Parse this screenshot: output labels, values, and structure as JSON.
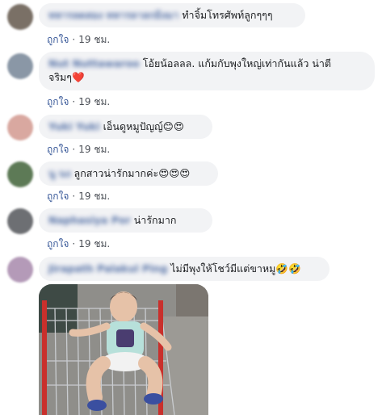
{
  "comments": [
    {
      "author": "ทหารลดสอง ทหารลาลกมิงมา",
      "text": "ทำจิ้มโทรศัพท์ลูกๆๆๆ",
      "like_label": "ถูกใจ",
      "time": "19 ชม.",
      "avatar_color": "#7a7066"
    },
    {
      "author": "Nut Nuttawaroo",
      "text_line1": "โอ้ยน้อลลล. แก้มกับพุงใหญ่เท่ากันแล้ว น่าตี",
      "text_line2": "จริมๆ❤️",
      "like_label": "ถูกใจ",
      "time": "19 ชม.",
      "avatar_color": "#8a97a6"
    },
    {
      "author": "Yuki Yuki",
      "text": "เอ็นดูหมูปัญญ์😊😍",
      "like_label": "ถูกใจ",
      "time": "19 ชม.",
      "avatar_color": "#d9a8a0"
    },
    {
      "author": "นู นง",
      "text": "ลูกสาวน่ารักมากค่ะ😍😍😍",
      "like_label": "ถูกใจ",
      "time": "19 ชม.",
      "avatar_color": "#5d7a56"
    },
    {
      "author": "Naphasiya Por",
      "text": "น่ารักมาก",
      "like_label": "ถูกใจ",
      "time": "19 ชม.",
      "avatar_color": "#6d6f73"
    },
    {
      "author": "Jirapath Palakul Ping",
      "text": "ไม่มีพุงให้โชว์มีแต่ขาหมู🤣🤣",
      "avatar_color": "#b49ab8"
    }
  ],
  "colors": {
    "bubble": "#f2f3f5",
    "link": "#385898",
    "meta": "#4b4f56"
  }
}
